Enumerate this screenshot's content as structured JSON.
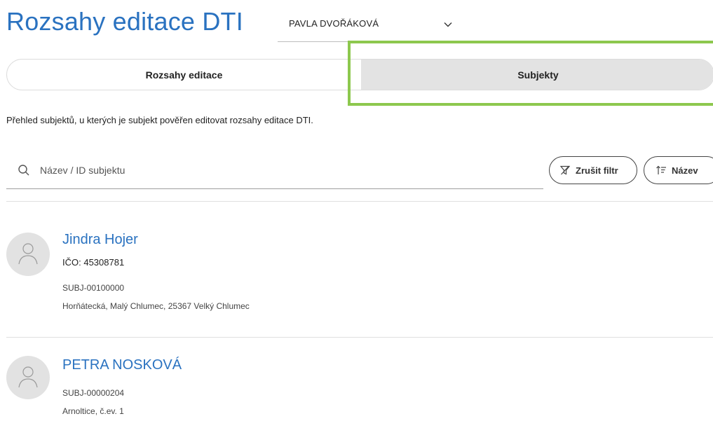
{
  "page": {
    "title": "Rozsahy editace DTI"
  },
  "user_select": {
    "value": "PAVLA DVOŘÁKOVÁ"
  },
  "tabs": [
    {
      "label": "Rozsahy editace",
      "active": false
    },
    {
      "label": "Subjekty",
      "active": true
    }
  ],
  "description": "Přehled subjektů, u kterých je subjekt pověřen editovat rozsahy editace DTI.",
  "search": {
    "placeholder": "Název / ID subjektu",
    "value": ""
  },
  "filters": {
    "clear_label": "Zrušit filtr",
    "sort_label": "Název"
  },
  "subjects": [
    {
      "name": "Jindra Hojer",
      "ico": "IČO: 45308781",
      "id": "SUBJ-00100000",
      "address": "Horňátecká, Malý Chlumec, 25367 Velký Chlumec"
    },
    {
      "name": "PETRA NOSKOVÁ",
      "ico": "",
      "id": "SUBJ-00000204",
      "address": "Arnoltice, č.ev. 1"
    }
  ],
  "colors": {
    "accent": "#2a72c0",
    "highlight": "#8dc84e",
    "active_tab": "#e3e3e3",
    "avatar_bg": "#e2e2e2"
  }
}
